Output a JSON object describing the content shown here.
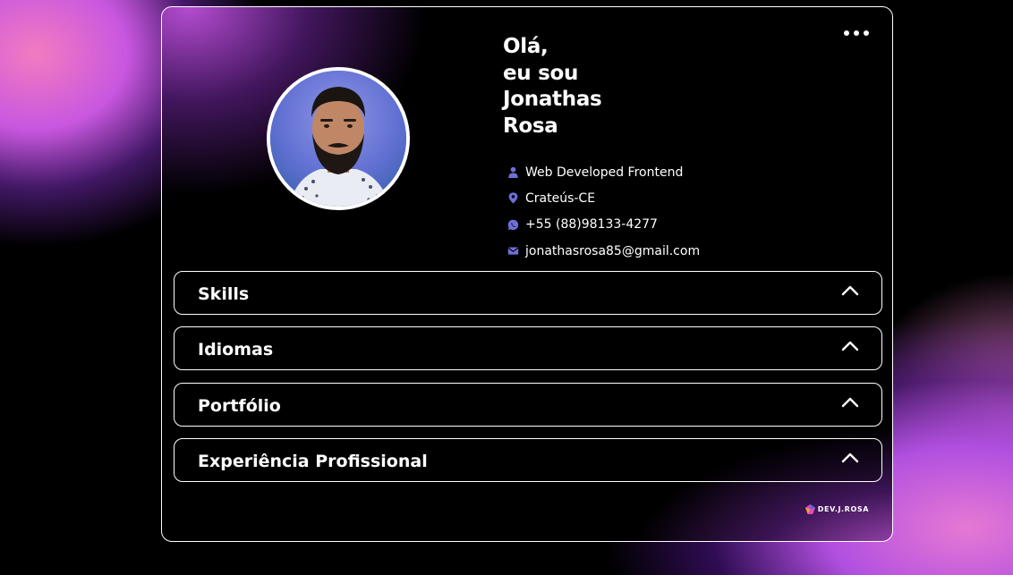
{
  "header": {
    "greeting_lines": [
      "Olá,",
      "eu sou",
      "Jonathas",
      "Rosa"
    ]
  },
  "profile": {
    "role": "Web Developed Frontend",
    "location": "Crateús-CE",
    "phone": "+55 (88)98133-4277",
    "email": "jonathasrosa85@gmail.com",
    "icons": [
      "user-icon",
      "location-pin-icon",
      "whatsapp-icon",
      "mail-icon"
    ]
  },
  "sections": [
    {
      "label": "Skills",
      "expanded": false
    },
    {
      "label": "Idiomas",
      "expanded": false
    },
    {
      "label": "Portfólio",
      "expanded": false
    },
    {
      "label": "Experiência Profissional",
      "expanded": false
    }
  ],
  "footer": {
    "logo_text": "DEV.J.ROSA"
  },
  "colors": {
    "icon_accent": "#6f6fd8",
    "card_border": "#ffffff",
    "background": "#000000",
    "gradient_pink": "#f27bc0",
    "gradient_purple": "#b14fe0"
  }
}
